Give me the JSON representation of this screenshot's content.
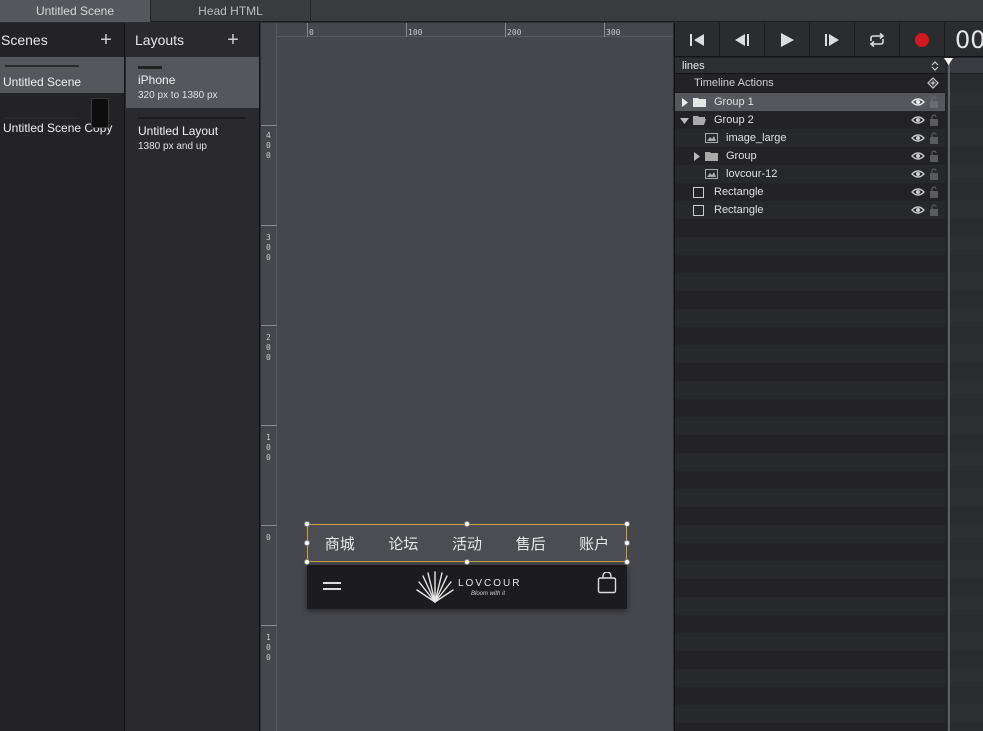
{
  "tabs": [
    {
      "label": "Untitled Scene",
      "active": true
    },
    {
      "label": "Head HTML",
      "active": false
    }
  ],
  "scenes": {
    "title": "Scenes",
    "items": [
      {
        "label": "Untitled Scene",
        "selected": true
      },
      {
        "label": "Untitled Scene Copy",
        "selected": false
      }
    ]
  },
  "layouts": {
    "title": "Layouts",
    "items": [
      {
        "name": "iPhone",
        "range": "320 px to 1380 px",
        "selected": true
      },
      {
        "name": "Untitled Layout",
        "range": "1380 px and up",
        "selected": false
      }
    ]
  },
  "ruler": {
    "top_labels": [
      "0",
      "100",
      "200",
      "300"
    ],
    "left_labels": [
      "4\n0\n0",
      "3\n0\n0",
      "2\n0\n0",
      "1\n0\n0",
      "0",
      "1\n0\n0"
    ]
  },
  "navbar": {
    "items": [
      "商城",
      "论坛",
      "活动",
      "售后",
      "账户"
    ]
  },
  "header": {
    "logo_text": "LOVCOUR",
    "logo_tagline": "Bloom with it"
  },
  "timeline": {
    "timecode": "00",
    "animation_name": "lines",
    "actions_label": "Timeline Actions",
    "layers": [
      {
        "label": "Group 1",
        "type": "folder",
        "indent": 0,
        "expanded": false,
        "selected": true
      },
      {
        "label": "Group 2",
        "type": "folder",
        "indent": 0,
        "expanded": true,
        "selected": false
      },
      {
        "label": "image_large",
        "type": "image",
        "indent": 1,
        "selected": false
      },
      {
        "label": "Group",
        "type": "folder",
        "indent": 1,
        "expanded": false,
        "selected": false
      },
      {
        "label": "lovcour-12",
        "type": "image",
        "indent": 1,
        "selected": false
      },
      {
        "label": "Rectangle",
        "type": "rect",
        "indent": 0,
        "selected": false
      },
      {
        "label": "Rectangle",
        "type": "rect",
        "indent": 0,
        "selected": false
      }
    ]
  },
  "colors": {
    "selection_border": "#c8a445",
    "record": "#d0191f",
    "selected_row": "#55575d"
  }
}
